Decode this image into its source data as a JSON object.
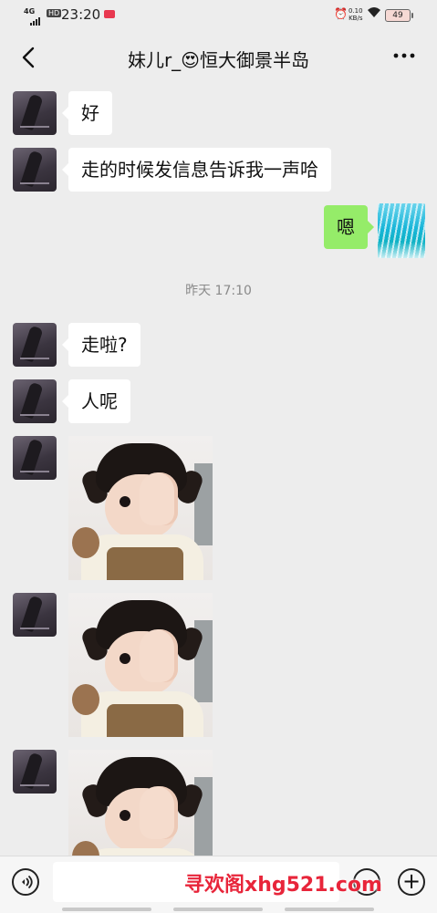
{
  "status_bar": {
    "network": "4G",
    "hd": "HD",
    "time": "23:20",
    "speed_value": "0.10",
    "speed_unit": "KB/s",
    "battery": "49"
  },
  "header": {
    "title": "妹儿r_😍恒大御景半岛",
    "back_icon": "chevron-left-icon",
    "more_icon": "more-dots-icon"
  },
  "messages": [
    {
      "side": "left",
      "type": "text",
      "text": "好"
    },
    {
      "side": "left",
      "type": "text",
      "text": "走的时候发信息告诉我一声哈"
    },
    {
      "side": "right",
      "type": "text",
      "text": "嗯"
    },
    {
      "side": "left",
      "type": "text",
      "text": "走啦?"
    },
    {
      "side": "left",
      "type": "text",
      "text": "人呢"
    },
    {
      "side": "left",
      "type": "image",
      "subject": "child-covering-eye-photo"
    },
    {
      "side": "left",
      "type": "image",
      "subject": "child-covering-eye-photo"
    },
    {
      "side": "left",
      "type": "image",
      "subject": "child-covering-eye-photo"
    }
  ],
  "timestamp": "昨天 17:10",
  "input_bar": {
    "placeholder": "",
    "voice_icon": "voice-icon",
    "emoji_icon": "emoji-icon",
    "plus_icon": "plus-icon",
    "plus_glyph": "+",
    "voice_glyph": "◗))"
  },
  "watermark": "寻欢阁xhg521.com"
}
